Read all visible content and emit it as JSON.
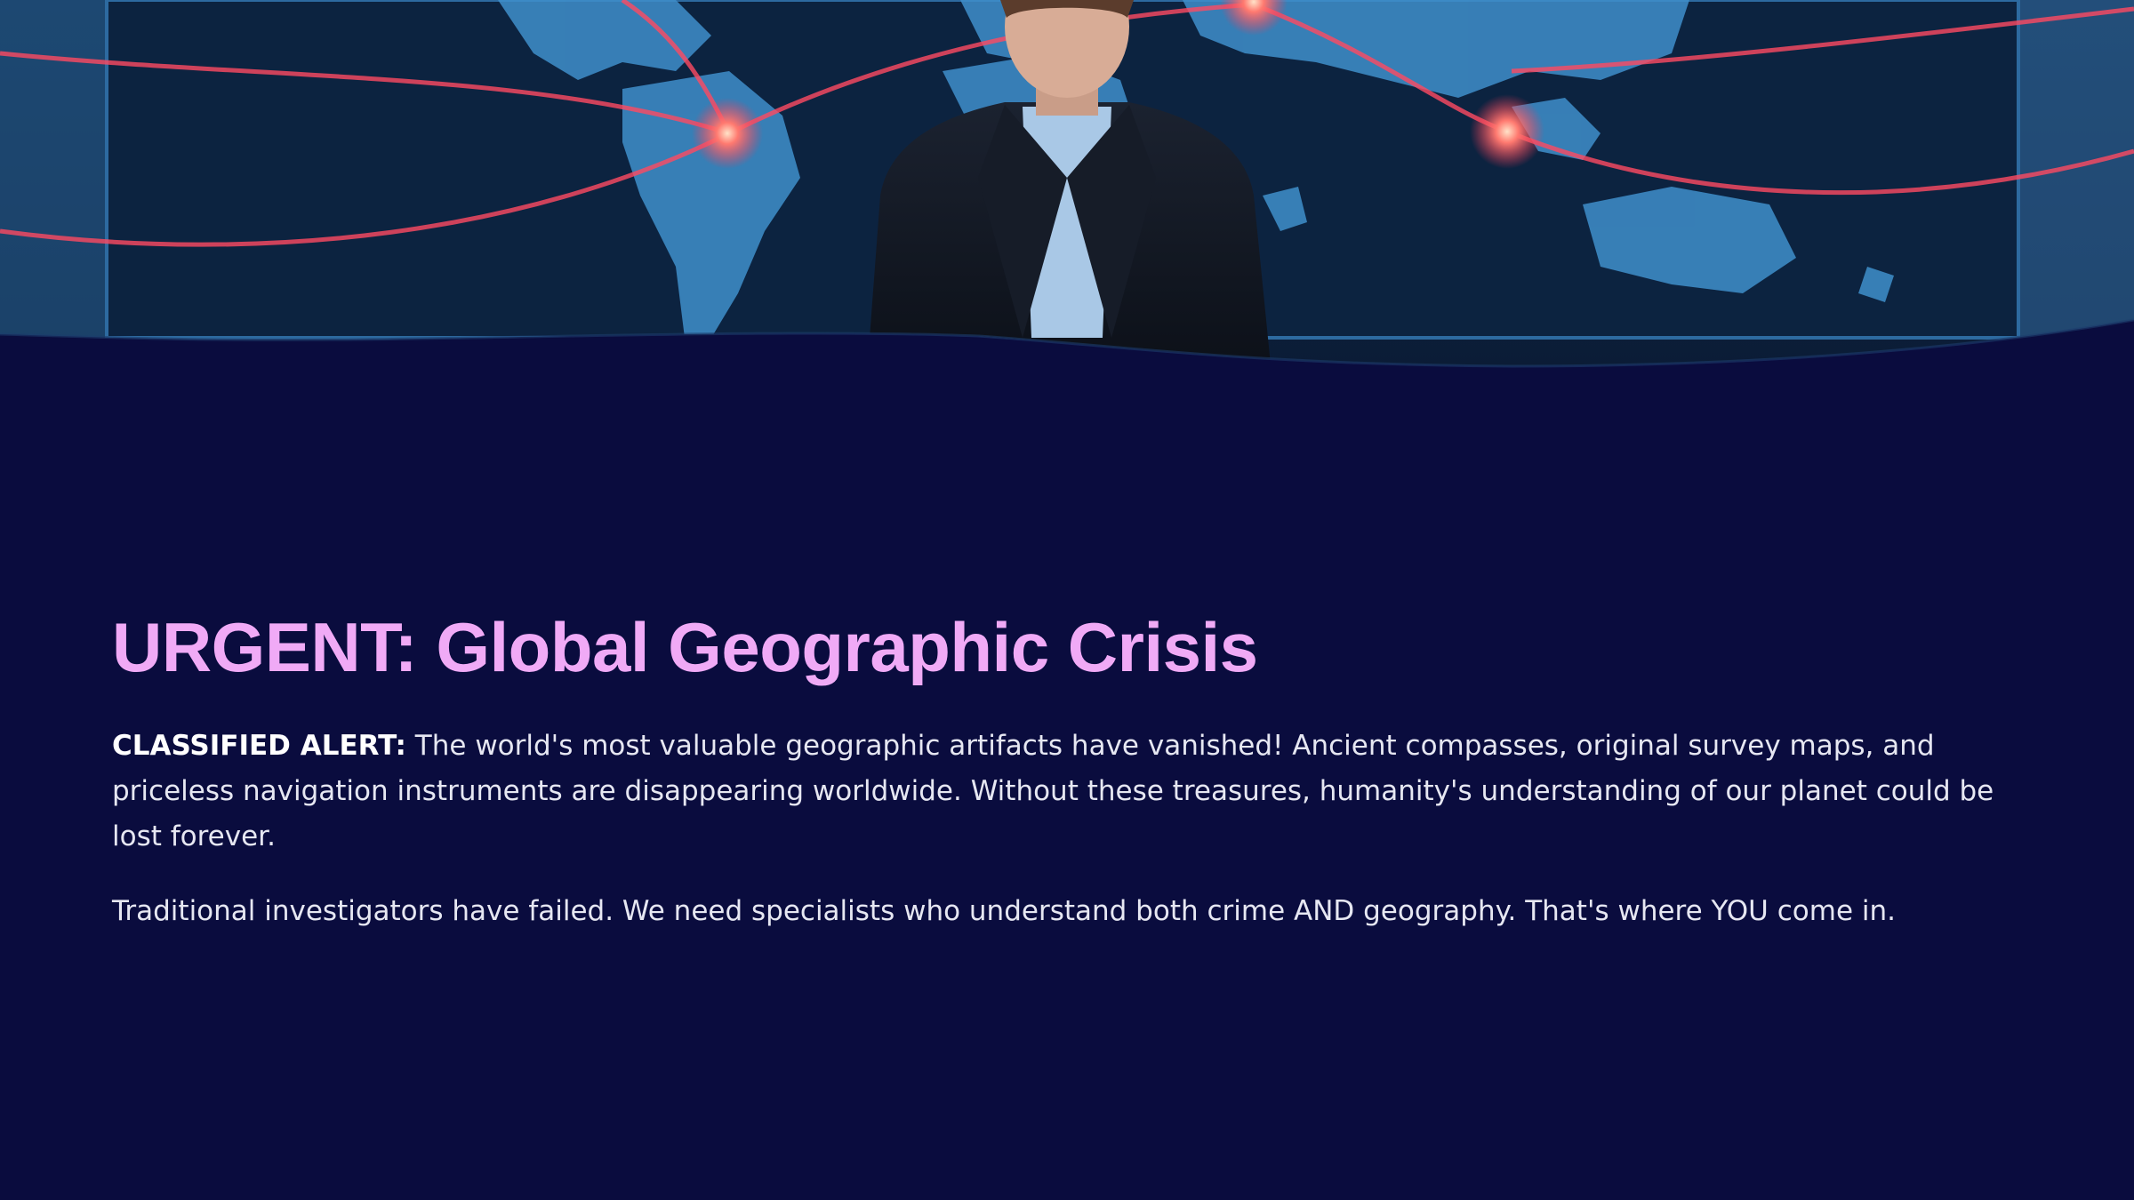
{
  "hero": {
    "image_alt": "Presenter in front of a glowing world map with red connection lines"
  },
  "title": "URGENT: Global Geographic Crisis",
  "paragraphs": {
    "p1_lead": "CLASSIFIED ALERT:",
    "p1_body": " The world's most valuable geographic artifacts have vanished! Ancient compasses, original survey maps, and priceless navigation instruments are disappearing worldwide. Without these treasures, humanity's understanding of our planet could be lost forever.",
    "p2": "Traditional investigators have failed. We need specialists who understand both crime AND geography. That's where YOU come in."
  },
  "colors": {
    "background": "#0a0c3e",
    "title": "#f0aaf6",
    "body_text": "#e6e7f2",
    "map_glow": "#ff5a6e"
  }
}
